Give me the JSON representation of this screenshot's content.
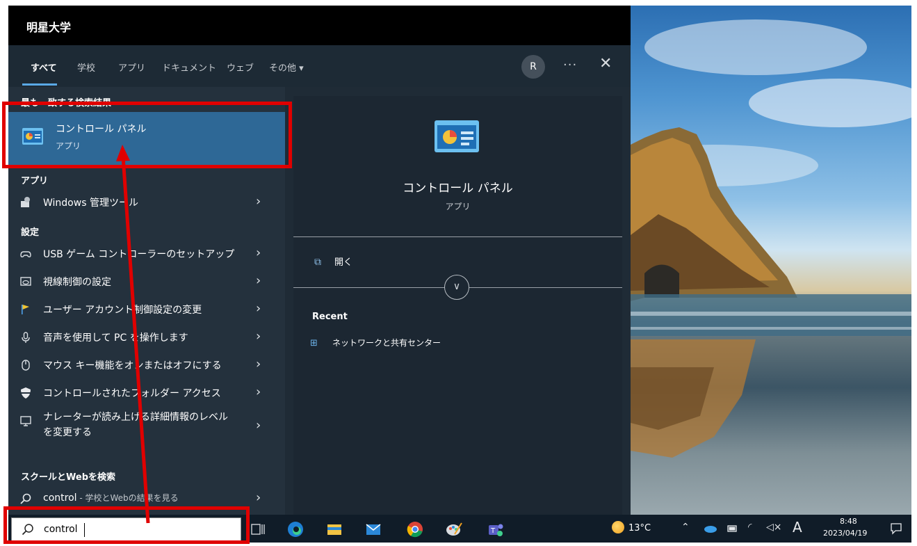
{
  "start_menu": {
    "org_name": "明星大学",
    "tabs": [
      "すべて",
      "学校",
      "アプリ",
      "ドキュメント",
      "ウェブ",
      "その他 ▾"
    ],
    "avatar_initial": "R",
    "more_label": "···",
    "close_label": "✕"
  },
  "results": {
    "best_match_header": "最も一致する検索結果",
    "best_match": {
      "title": "コントロール パネル",
      "subtitle": "アプリ",
      "icon": "control-panel-icon"
    },
    "apps_header": "アプリ",
    "apps": [
      {
        "label": "Windows 管理ツール",
        "icon": "admin-tools-icon"
      }
    ],
    "settings_header": "設定",
    "settings": [
      {
        "label": "USB ゲーム コントローラーのセットアップ",
        "icon": "gamepad-icon"
      },
      {
        "label": "視線制御の設定",
        "icon": "eye-control-icon"
      },
      {
        "label": "ユーザー アカウント制御設定の変更",
        "icon": "flag-icon"
      },
      {
        "label": "音声を使用して PC を操作します",
        "icon": "microphone-icon"
      },
      {
        "label": "マウス キー機能をオンまたはオフにする",
        "icon": "mouse-icon"
      },
      {
        "label": "コントロールされたフォルダー アクセス",
        "icon": "shield-icon"
      },
      {
        "label": "ナレーターが読み上げる詳細情報のレベルを変更する",
        "line1": "ナレーターが読み上げる詳細情報のレベル",
        "line2": "を変更する",
        "icon": "narrator-icon"
      }
    ],
    "web_header": "スクールとWebを検索",
    "web_query": "control",
    "web_suffix": " - 学校とWebの結果を見る"
  },
  "detail": {
    "title": "コントロール パネル",
    "subtitle": "アプリ",
    "open_label": "開く",
    "recent_header": "Recent",
    "recent_items": [
      "ネットワークと共有センター"
    ]
  },
  "taskbar": {
    "search_value": "control",
    "weather": "13°C",
    "time": "8:48",
    "date": "2023/04/19",
    "ime_label": "A",
    "icons": [
      "task-view-icon",
      "edge-icon",
      "file-explorer-icon",
      "mail-icon",
      "chrome-icon",
      "paint-icon",
      "teams-icon"
    ]
  },
  "colors": {
    "highlight": "#e00000",
    "best_match_bg": "#2e6896",
    "accent": "#5aa9e6"
  }
}
